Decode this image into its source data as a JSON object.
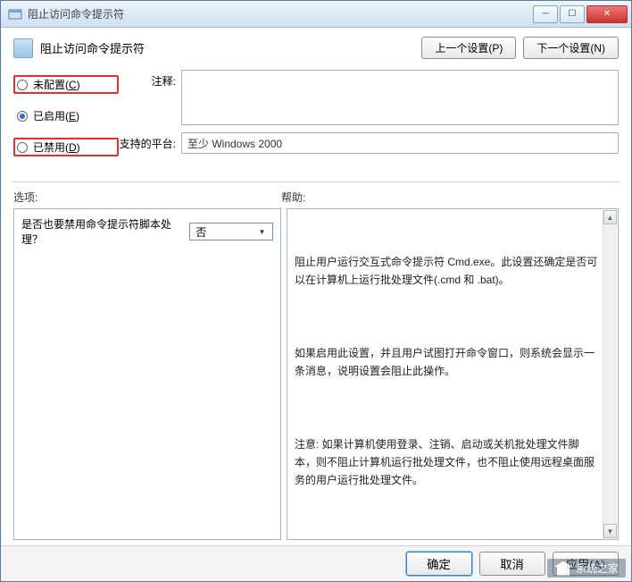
{
  "titlebar": {
    "title": "阻止访问命令提示符"
  },
  "header": {
    "title": "阻止访问命令提示符",
    "prev": "上一个设置(P)",
    "next": "下一个设置(N)"
  },
  "radios": {
    "not_configured": "未配置(C)",
    "enabled": "已启用(E)",
    "disabled": "已禁用(D)",
    "selected": "enabled"
  },
  "fields": {
    "comment_label": "注释:",
    "comment_value": "",
    "platform_label": "支持的平台:",
    "platform_value": "至少 Windows 2000"
  },
  "sections": {
    "options_label": "选项:",
    "help_label": "帮助:"
  },
  "options": {
    "question": "是否也要禁用命令提示符脚本处理？",
    "select_value": "否"
  },
  "help": {
    "p1": "阻止用户运行交互式命令提示符 Cmd.exe。此设置还确定是否可以在计算机上运行批处理文件(.cmd 和 .bat)。",
    "p2": "如果启用此设置，并且用户试图打开命令窗口，则系统会显示一条消息，说明设置会阻止此操作。",
    "p3": "注意: 如果计算机使用登录、注销、启动或关机批处理文件脚本，则不阻止计算机运行批处理文件，也不阻止使用远程桌面服务的用户运行批处理文件。"
  },
  "footer": {
    "ok": "确定",
    "cancel": "取消",
    "apply": "应用(A)"
  },
  "watermark": {
    "text": "系统之家"
  }
}
